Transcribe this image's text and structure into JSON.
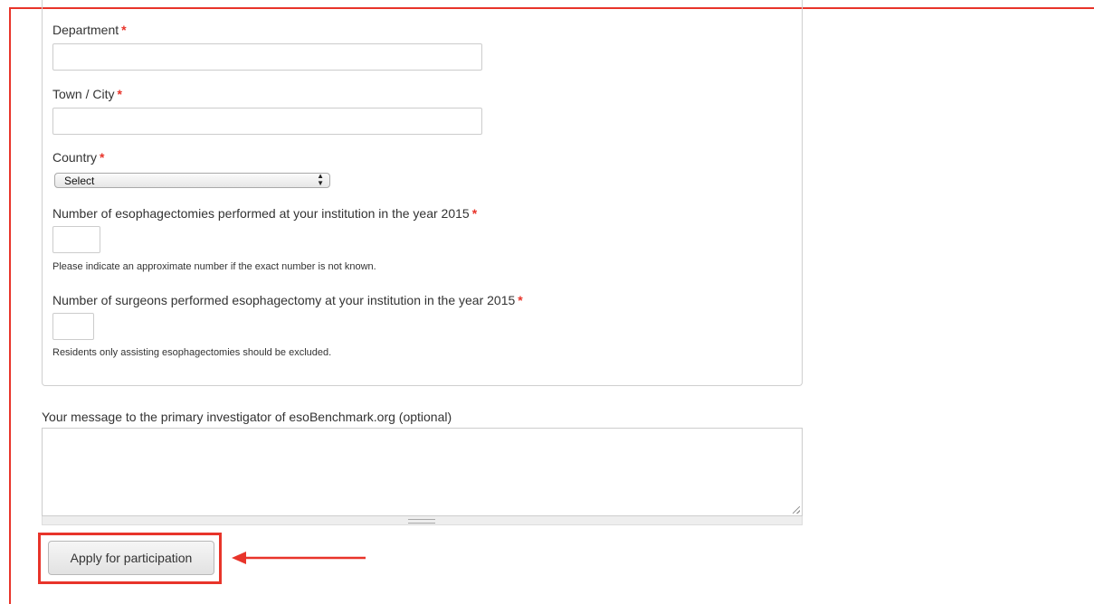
{
  "form": {
    "department": {
      "label": "Department",
      "required_mark": "*",
      "value": ""
    },
    "town_city": {
      "label": "Town / City",
      "required_mark": "*",
      "value": ""
    },
    "country": {
      "label": "Country",
      "required_mark": "*",
      "selected": "Select"
    },
    "esophagectomies": {
      "label": "Number of esophagectomies performed at your institution in the year 2015",
      "required_mark": "*",
      "value": "",
      "help": "Please indicate an approximate number if the exact number is not known."
    },
    "surgeons": {
      "label": "Number of surgeons performed esophagectomy at your institution in the year 2015",
      "required_mark": "*",
      "value": "",
      "help": "Residents only assisting esophagectomies should be excluded."
    },
    "message": {
      "label": "Your message to the primary investigator of esoBenchmark.org (optional)",
      "value": ""
    },
    "submit_label": "Apply for participation"
  },
  "icons": {
    "select_arrows": "up-down-chevron-icon",
    "annotation_arrow": "left-arrow-icon"
  },
  "colors": {
    "required": "#e8342a",
    "highlight": "#e8342a",
    "border": "#cccccc"
  }
}
